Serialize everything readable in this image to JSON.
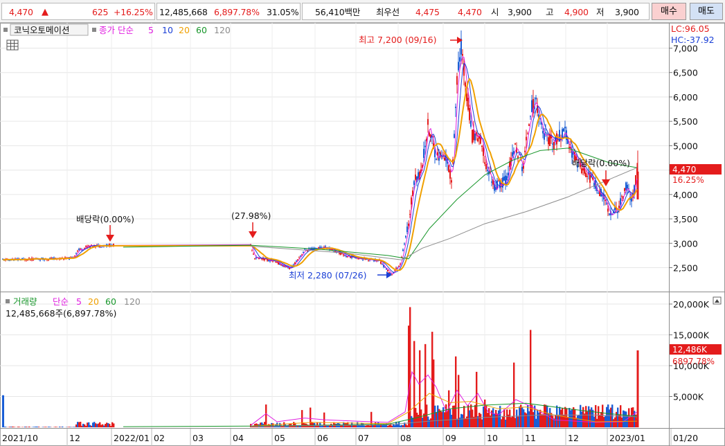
{
  "quote": {
    "price": "4,470",
    "up_arrow": "▲",
    "change": "625",
    "change_pct": "+16.25%",
    "volume": "12,485,668",
    "volume_ratio": "6,897.78%",
    "turnover": "31.05%",
    "value": "56,410백만",
    "best_label": "최우선",
    "best_ask": "4,475",
    "best_bid": "4,470",
    "open_label": "시",
    "open": "3,900",
    "high_label": "고",
    "high": "4,900",
    "low_label": "저",
    "low": "3,900",
    "buy_label": "매수",
    "sell_label": "매도"
  },
  "price_panel": {
    "stock_name": "코닉오토메이션",
    "ma_label": "종가 단순",
    "ma_periods": [
      "5",
      "10",
      "20",
      "60",
      "120"
    ],
    "lc_label": "LC:96.05",
    "hc_label": "HC:-37.92",
    "y_ticks": [
      "7,000",
      "6,500",
      "6,000",
      "5,500",
      "5,000",
      "4,500",
      "4,000",
      "3,500",
      "3,000",
      "2,500"
    ],
    "current_price_label": "4,470",
    "current_pct_label": "16.25%",
    "annotations": {
      "dividend_1": "배당락(0.00%)",
      "pct_apr": "(27.98%)",
      "dividend_2": "배당락(0.00%)",
      "high_marker": "최고 7,200 (09/16)",
      "low_marker": "최저 2,280 (07/26)"
    }
  },
  "volume_panel": {
    "title": "거래량",
    "ma_label": "단순",
    "ma_periods": [
      "5",
      "20",
      "60",
      "120"
    ],
    "summary": "12,485,668주(6,897.78%)",
    "y_ticks": [
      "20,000K",
      "15,000K",
      "10,000K",
      "5,000K"
    ],
    "current_volume_label": "12,486K",
    "current_pct_label": "6897.78%"
  },
  "x_axis": {
    "labels": [
      "2021/10",
      "12",
      "2022/01",
      "02",
      "03",
      "04",
      "05",
      "06",
      "07",
      "08",
      "09",
      "10",
      "11",
      "12",
      "2023/01",
      "01/20"
    ]
  },
  "colors": {
    "up": "#e41c1c",
    "down": "#1a5ed6",
    "ma5": "#e01de0",
    "ma10": "#1a3fd6",
    "ma20": "#f0a000",
    "ma60": "#17962a",
    "ma120": "#8c8c8c"
  },
  "chart_data": {
    "type": "candlestick",
    "y_range": [
      2000,
      7200
    ],
    "high": {
      "value": 7200,
      "date": "09/16"
    },
    "low": {
      "value": 2280,
      "date": "07/26"
    },
    "last": {
      "value": 4470,
      "change_pct": 16.25,
      "volume_k": 12486
    },
    "volume_y_range": [
      0,
      20000
    ]
  }
}
